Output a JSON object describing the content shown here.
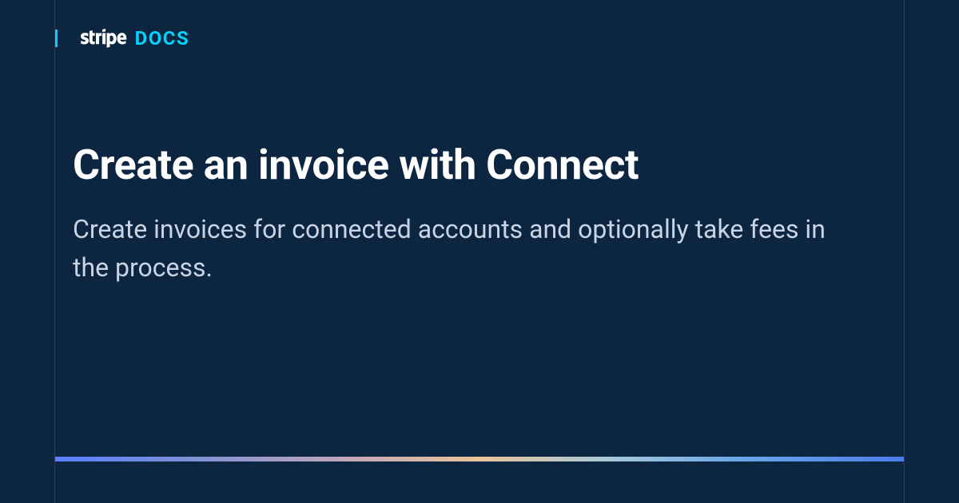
{
  "header": {
    "brand_name": "stripe",
    "section_label": "DOCS"
  },
  "main": {
    "title": "Create an invoice with Connect",
    "subtitle": "Create invoices for connected accounts and optionally take fees in the process."
  },
  "colors": {
    "background": "#0c2540",
    "accent": "#00d4ff",
    "title": "#ffffff",
    "subtitle": "#c9d4e4"
  }
}
